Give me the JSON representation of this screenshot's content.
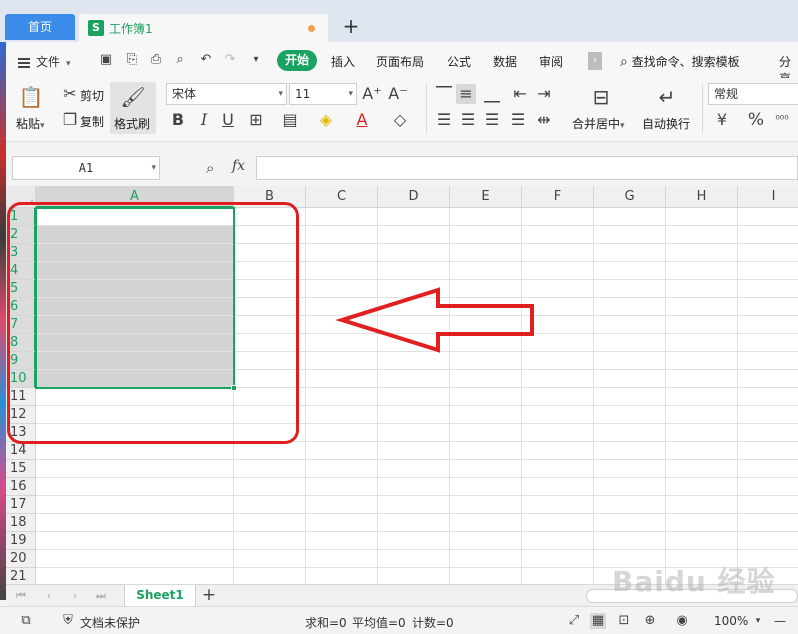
{
  "tabs": {
    "home": "首页",
    "document": "工作簿1",
    "document_icon": "S",
    "add": "+"
  },
  "menu": {
    "file": "文件",
    "items": [
      "开始",
      "插入",
      "页面布局",
      "公式",
      "数据",
      "审阅"
    ],
    "more": "›",
    "search": "查找命令、搜索模板",
    "share": "分享"
  },
  "ribbon": {
    "paste": "粘贴",
    "cut": "剪切",
    "copy": "复制",
    "format_painter": "格式刷",
    "font_name": "宋体",
    "font_size": "11",
    "merge_center": "合并居中",
    "wrap_text": "自动换行",
    "number_format": "常规",
    "grow_font": "A⁺",
    "shrink_font": "A⁻",
    "bold": "B",
    "italic": "I",
    "underline": "U",
    "percent": "%",
    "comma": "⁰⁰⁰"
  },
  "formula_bar": {
    "name_box": "A1",
    "fx": "fx",
    "formula": ""
  },
  "grid": {
    "columns": [
      "A",
      "B",
      "C",
      "D",
      "E",
      "F",
      "G",
      "H",
      "I"
    ],
    "rows": [
      "1",
      "2",
      "3",
      "4",
      "5",
      "6",
      "7",
      "8",
      "9",
      "10",
      "11",
      "12",
      "13",
      "14",
      "15",
      "16",
      "17",
      "18",
      "19",
      "20",
      "21"
    ],
    "selected_column": "A",
    "selected_rows": [
      "1",
      "2",
      "3",
      "4",
      "5",
      "6",
      "7",
      "8",
      "9",
      "10"
    ]
  },
  "sheets": {
    "names": [
      "Sheet1"
    ],
    "add": "+"
  },
  "status": {
    "protection": "文档未保护",
    "sum": "求和=0",
    "average": "平均值=0",
    "count": "计数=0",
    "zoom": "100%",
    "zoom_out": "—"
  },
  "watermark": "Baidu 经验",
  "colors": {
    "accent": "#1aa260",
    "annotation": "#e02020",
    "home_tab": "#3b8ce9"
  }
}
